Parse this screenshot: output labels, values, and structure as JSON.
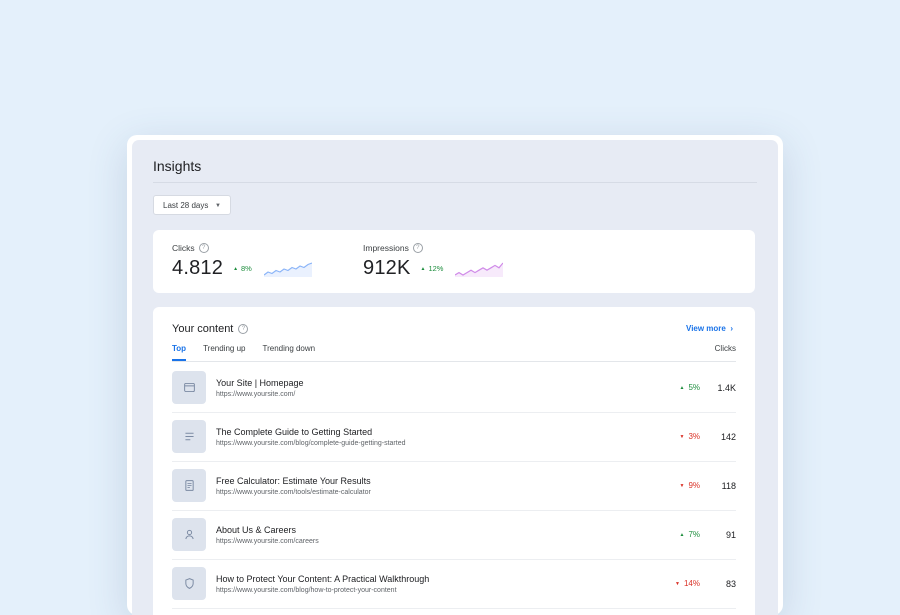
{
  "page": {
    "title": "Insights",
    "date_range": "Last 28 days"
  },
  "stats": [
    {
      "label": "Clicks",
      "value": "4.812",
      "change": "8%",
      "direction": "up",
      "color": "#8ab4f8",
      "sparkline": [
        4,
        6,
        5,
        7,
        6,
        8,
        7,
        9,
        8,
        10,
        9,
        11,
        12
      ]
    },
    {
      "label": "Impressions",
      "value": "912K",
      "change": "12%",
      "direction": "up",
      "color": "#d08be8",
      "sparkline": [
        5,
        6,
        5,
        6,
        7,
        6,
        7,
        8,
        7,
        8,
        9,
        8,
        10
      ]
    }
  ],
  "content": {
    "title": "Your content",
    "view_more": "View more",
    "tabs": [
      "Top",
      "Trending up",
      "Trending down"
    ],
    "active_tab": "Top",
    "column_header": "Clicks",
    "rows": [
      {
        "title": "Your Site | Homepage",
        "url": "https://www.yoursite.com/",
        "change": "5%",
        "direction": "up",
        "clicks": "1.4K",
        "icon": "browser-icon"
      },
      {
        "title": "The Complete Guide to Getting Started",
        "url": "https://www.yoursite.com/blog/complete-guide-getting-started",
        "change": "3%",
        "direction": "down",
        "clicks": "142",
        "icon": "text-lines-icon"
      },
      {
        "title": "Free Calculator: Estimate Your Results",
        "url": "https://www.yoursite.com/tools/estimate-calculator",
        "change": "9%",
        "direction": "down",
        "clicks": "118",
        "icon": "document-icon"
      },
      {
        "title": "About Us & Careers",
        "url": "https://www.yoursite.com/careers",
        "change": "7%",
        "direction": "up",
        "clicks": "91",
        "icon": "person-icon"
      },
      {
        "title": "How to Protect Your Content: A Practical Walkthrough",
        "url": "https://www.yoursite.com/blog/how-to-protect-your-content",
        "change": "14%",
        "direction": "down",
        "clicks": "83",
        "icon": "shield-icon"
      }
    ]
  },
  "colors": {
    "accent": "#1a73e8",
    "positive": "#1e8e3e",
    "negative": "#d93025",
    "background": "#e4f0fb"
  }
}
